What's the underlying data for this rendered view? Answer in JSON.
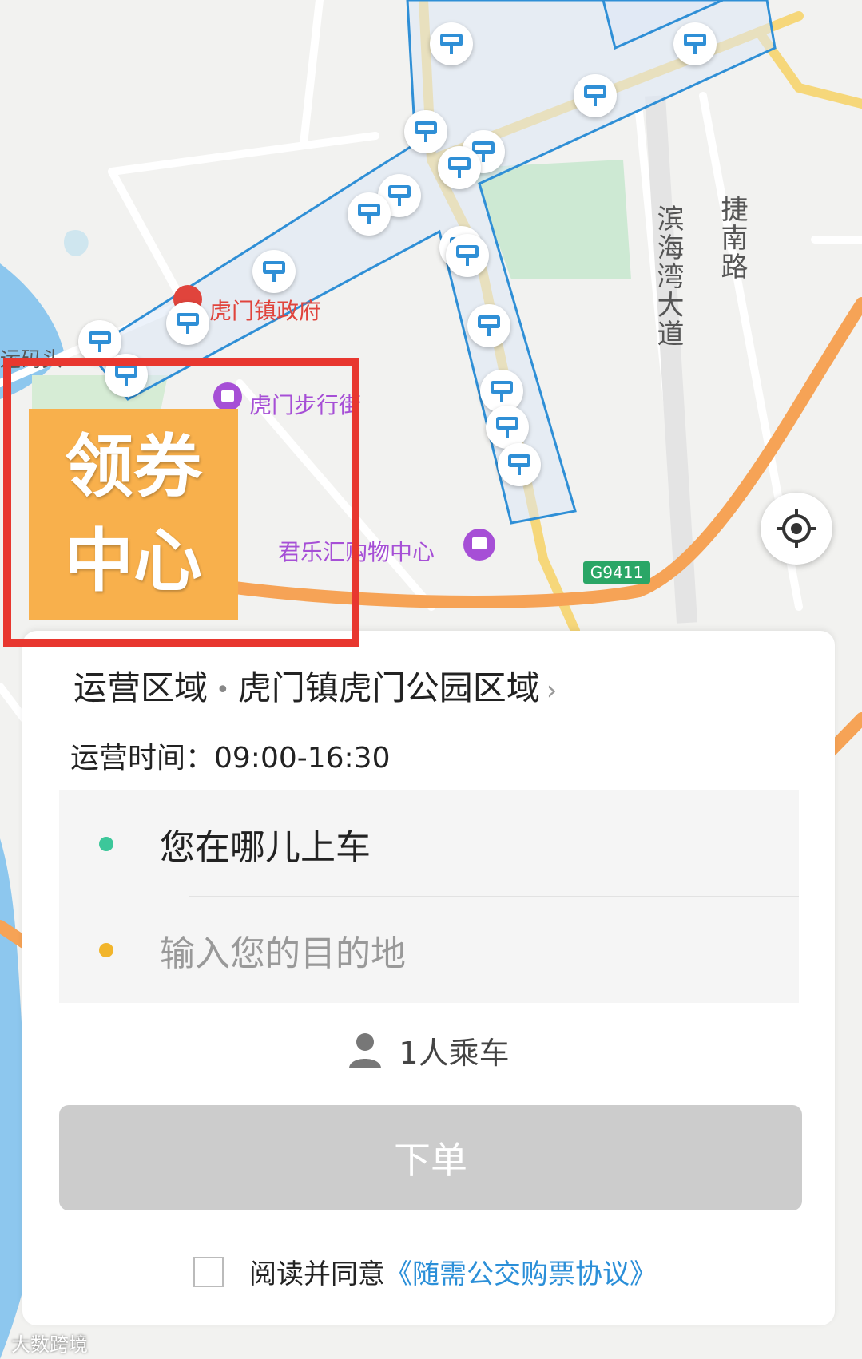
{
  "map": {
    "stop_icon": "bus-stop-icon",
    "stop_count": 17,
    "pois": {
      "gov": "虎门镇政府",
      "street": "虎门步行街",
      "mall": "君乐汇购物中心",
      "pier": "运码头"
    },
    "roads": {
      "binhai": "滨海湾大道",
      "jienan": "捷南路",
      "highway_badge": "G9411"
    },
    "colors": {
      "zone_border": "#2f8fd6",
      "zone_fill": "#dde8f5",
      "major_road": "#f6a356",
      "water": "#8dc7ee",
      "park": "#cde9d3",
      "gov_poi": "#e0443c",
      "shop_poi": "#a64fd6",
      "highway_badge": "#2aa666"
    }
  },
  "locate_button": {
    "icon": "crosshair-locate-icon"
  },
  "coupon_center": {
    "line1": "领券",
    "line2": "中心"
  },
  "panel": {
    "area_label": "运营区域",
    "area_name": "虎门镇虎门公园区域",
    "hours": "运营时间：09:00-16:30",
    "pickup": "您在哪儿上车",
    "destination_placeholder": "输入您的目的地",
    "passengers": "1人乘车",
    "order_button": "下单",
    "agree_text": "阅读并同意",
    "agree_link": "《随需公交购票协议》",
    "pickup_dot_color": "#3cc79a",
    "destination_dot_color": "#f2b52b"
  },
  "watermark": "大数跨境"
}
